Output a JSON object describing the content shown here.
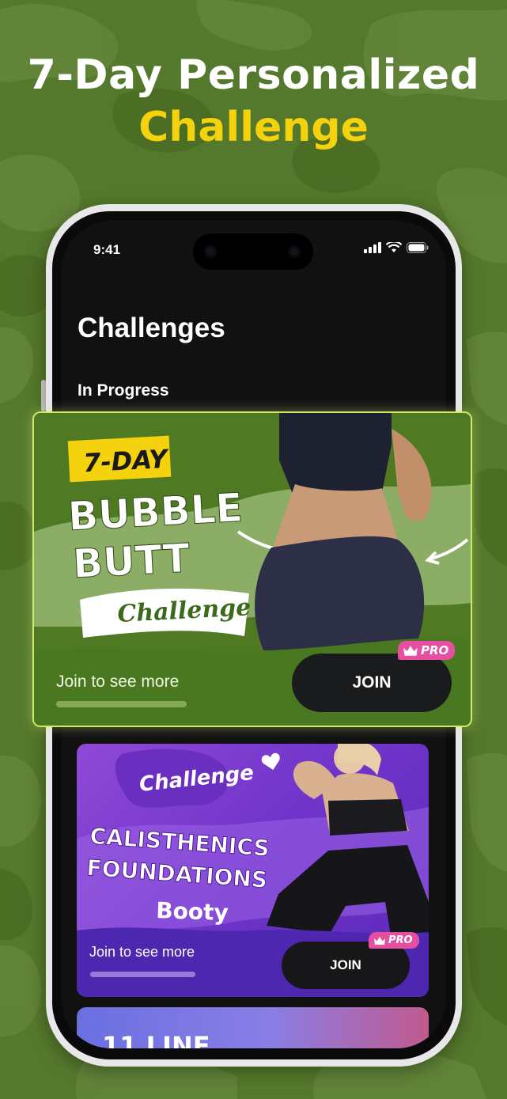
{
  "headline": {
    "line1": "7-Day Personalized",
    "line2": "Challenge"
  },
  "status_bar": {
    "time": "9:41"
  },
  "screen": {
    "title": "Challenges",
    "section": "In Progress"
  },
  "featured_card": {
    "badge": "7-DAY",
    "title_line1": "BUBBLE",
    "title_line2": "BUTT",
    "subtitle": "Challenge",
    "tagline": "Join to see more",
    "join_label": "JOIN",
    "pro_label": "PRO"
  },
  "second_card": {
    "badge": "Challenge",
    "title_line1": "CALISTHENICS",
    "title_line2": "FOUNDATIONS",
    "subtitle": "Booty",
    "tagline": "Join to see more",
    "join_label": "JOIN",
    "pro_label": "PRO"
  },
  "third_card": {
    "title_partial": "11 LINE"
  },
  "colors": {
    "background": "#55792c",
    "headline_accent": "#f5d20e",
    "featured_card": "#4f7a23",
    "featured_border": "#cde86a",
    "second_card": "#7a3bd0",
    "pro_badge": "#e64fa1",
    "join_button": "#1a1b1c"
  },
  "icons": [
    "signal-icon",
    "wifi-icon",
    "battery-icon",
    "crown-icon",
    "heart-icon",
    "arrow-icon"
  ]
}
